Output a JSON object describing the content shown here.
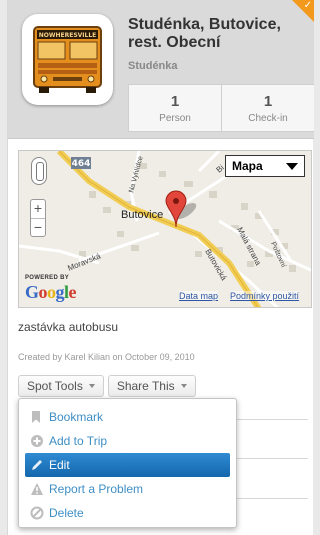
{
  "header": {
    "title": "Studénka, Butovice, rest. Obecní",
    "subtitle": "Studénka",
    "corner_badge": "✓",
    "icon_sign": "NOWHERESVILLE"
  },
  "stats": [
    {
      "value": "1",
      "label": "Person"
    },
    {
      "value": "1",
      "label": "Check-in"
    }
  ],
  "map": {
    "type_selector": "Mapa",
    "powered_by": "POWERED BY",
    "logo_text": "Google",
    "map_data_link": "Data map",
    "terms_link": "Podmínky použití",
    "road_label": "464",
    "place_labels": [
      "Butovice",
      "Moravská",
      "Butovická",
      "Malá strana",
      "Na Vyhlídce",
      "Poštovní",
      "Bi"
    ],
    "zoom_in": "+",
    "zoom_out": "−"
  },
  "spot": {
    "description": "zastávka autobusu",
    "created": "Created by Karel Kilian on October 09, 2010"
  },
  "toolbar": {
    "spot_tools": "Spot Tools",
    "share_this": "Share This"
  },
  "menu": [
    {
      "label": "Bookmark",
      "icon": "bookmark-icon",
      "active": false
    },
    {
      "label": "Add to Trip",
      "icon": "add-circle-icon",
      "active": false
    },
    {
      "label": "Edit",
      "icon": "pencil-icon",
      "active": true
    },
    {
      "label": "Report a Problem",
      "icon": "warning-icon",
      "active": false
    },
    {
      "label": "Delete",
      "icon": "delete-icon",
      "active": false
    }
  ],
  "colors": {
    "accent": "#f39a1e",
    "link": "#3e8ec4",
    "menu_active": "#1f77c0"
  }
}
